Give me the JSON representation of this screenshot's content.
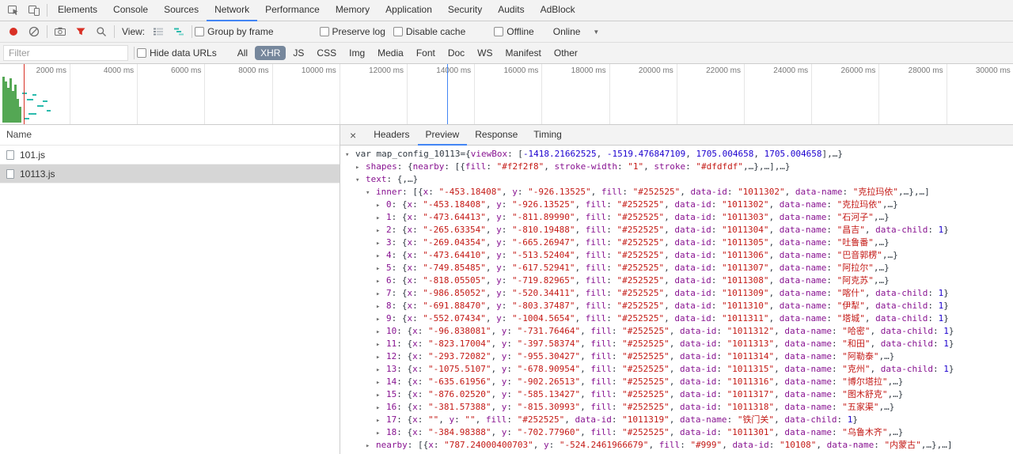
{
  "colors": {
    "accent_blue": "#4285f4",
    "record_red": "#d93025",
    "filter_red": "#d93025",
    "chip_bg": "#76879c",
    "chip_fg": "#ffffff",
    "selection_gray": "#d6d6d6",
    "key": "#881391",
    "string": "#c41a16",
    "number": "#1c00cf",
    "plain": "#303942",
    "bar_green": "#54a754",
    "dash_teal": "#2bbbad",
    "event_blue": "#4285f4",
    "event_red": "#d93025"
  },
  "main_tabs": {
    "items": [
      "Elements",
      "Console",
      "Sources",
      "Network",
      "Performance",
      "Memory",
      "Application",
      "Security",
      "Audits",
      "AdBlock"
    ],
    "active": "Network"
  },
  "net_toolbar": {
    "view_label": "View:",
    "checkboxes": [
      {
        "label": "Group by frame",
        "checked": false
      },
      {
        "label": "Preserve log",
        "checked": false
      },
      {
        "label": "Disable cache",
        "checked": false
      },
      {
        "label": "Offline",
        "checked": false
      }
    ],
    "throttling": {
      "value": "Online"
    }
  },
  "filter_bar": {
    "placeholder": "Filter",
    "hide_data_urls": {
      "label": "Hide data URLs",
      "checked": false
    },
    "types": [
      "All",
      "XHR",
      "JS",
      "CSS",
      "Img",
      "Media",
      "Font",
      "Doc",
      "WS",
      "Manifest",
      "Other"
    ],
    "active_type": "XHR"
  },
  "overview": {
    "tick_labels": [
      "2000 ms",
      "4000 ms",
      "6000 ms",
      "8000 ms",
      "10000 ms",
      "12000 ms",
      "14000 ms",
      "16000 ms",
      "18000 ms",
      "20000 ms",
      "22000 ms",
      "24000 ms",
      "26000 ms",
      "28000 ms",
      "30000 ms"
    ],
    "green_bars": [
      [
        3,
        16,
        58
      ],
      [
        6,
        22,
        52
      ],
      [
        9,
        30,
        44
      ],
      [
        12,
        18,
        56
      ],
      [
        15,
        34,
        40
      ],
      [
        18,
        26,
        48
      ],
      [
        21,
        44,
        30
      ],
      [
        24,
        54,
        20
      ]
    ],
    "teal_dashes": [
      [
        28,
        36,
        6
      ],
      [
        34,
        44,
        8
      ],
      [
        41,
        38,
        5
      ],
      [
        47,
        52,
        8
      ],
      [
        54,
        46,
        6
      ],
      [
        59,
        58,
        5
      ],
      [
        36,
        62,
        10
      ],
      [
        30,
        68,
        7
      ]
    ],
    "event_lines": [
      [
        30,
        "red"
      ],
      [
        565,
        "blue"
      ]
    ]
  },
  "requests": {
    "name_header": "Name",
    "rows": [
      {
        "name": "101.js",
        "selected": false
      },
      {
        "name": "10113.js",
        "selected": true
      }
    ]
  },
  "detail_tabs": {
    "close": "×",
    "items": [
      "Headers",
      "Preview",
      "Response",
      "Timing"
    ],
    "active": "Preview"
  },
  "preview": {
    "header_lines": [
      {
        "ind": 0,
        "ar": "e",
        "tk": [
          [
            "p",
            "var map_config_10113={"
          ],
          [
            "k",
            "viewBox"
          ],
          [
            "p",
            ": ["
          ],
          [
            "n",
            "-1418.21662525"
          ],
          [
            "p",
            ", "
          ],
          [
            "n",
            "-1519.476847109"
          ],
          [
            "p",
            ", "
          ],
          [
            "n",
            "1705.004658"
          ],
          [
            "p",
            ", "
          ],
          [
            "n",
            "1705.004658"
          ],
          [
            "p",
            "],…}"
          ]
        ]
      },
      {
        "ind": 1,
        "ar": "c",
        "tk": [
          [
            "k",
            "shapes"
          ],
          [
            "p",
            ": {"
          ],
          [
            "k",
            "nearby"
          ],
          [
            "p",
            ": [{"
          ],
          [
            "k",
            "fill"
          ],
          [
            "p",
            ": "
          ],
          [
            "s",
            "\"#f2f2f8\""
          ],
          [
            "p",
            ", "
          ],
          [
            "k",
            "stroke-width"
          ],
          [
            "p",
            ": "
          ],
          [
            "s",
            "\"1\""
          ],
          [
            "p",
            ", "
          ],
          [
            "k",
            "stroke"
          ],
          [
            "p",
            ": "
          ],
          [
            "s",
            "\"#dfdfdf\""
          ],
          [
            "p",
            ",…},…],…}"
          ]
        ]
      },
      {
        "ind": 1,
        "ar": "e",
        "tk": [
          [
            "k",
            "text"
          ],
          [
            "p",
            ": {,…}"
          ]
        ]
      },
      {
        "ind": 2,
        "ar": "e",
        "tk": [
          [
            "k",
            "inner"
          ],
          [
            "p",
            ": [{"
          ],
          [
            "k",
            "x"
          ],
          [
            "p",
            ": "
          ],
          [
            "s",
            "\"-453.18408\""
          ],
          [
            "p",
            ", "
          ],
          [
            "k",
            "y"
          ],
          [
            "p",
            ": "
          ],
          [
            "s",
            "\"-926.13525\""
          ],
          [
            "p",
            ", "
          ],
          [
            "k",
            "fill"
          ],
          [
            "p",
            ": "
          ],
          [
            "s",
            "\"#252525\""
          ],
          [
            "p",
            ", "
          ],
          [
            "k",
            "data-id"
          ],
          [
            "p",
            ": "
          ],
          [
            "s",
            "\"1011302\""
          ],
          [
            "p",
            ", "
          ],
          [
            "k",
            "data-name"
          ],
          [
            "p",
            ": "
          ],
          [
            "s",
            "\"克拉玛依\""
          ],
          [
            "p",
            ",…},…]"
          ]
        ]
      }
    ],
    "inner_rows": [
      {
        "i": "0",
        "x": "-453.18408",
        "y": "-926.13525",
        "fill": "#252525",
        "id": "1011302",
        "name": "克拉玛依",
        "child": false
      },
      {
        "i": "1",
        "x": "-473.64413",
        "y": "-811.89990",
        "fill": "#252525",
        "id": "1011303",
        "name": "石河子",
        "child": false
      },
      {
        "i": "2",
        "x": "-265.63354",
        "y": "-810.19488",
        "fill": "#252525",
        "id": "1011304",
        "name": "昌吉",
        "child": true
      },
      {
        "i": "3",
        "x": "-269.04354",
        "y": "-665.26947",
        "fill": "#252525",
        "id": "1011305",
        "name": "吐鲁番",
        "child": false
      },
      {
        "i": "4",
        "x": "-473.64410",
        "y": "-513.52404",
        "fill": "#252525",
        "id": "1011306",
        "name": "巴音郭楞",
        "child": false
      },
      {
        "i": "5",
        "x": "-749.85485",
        "y": "-617.52941",
        "fill": "#252525",
        "id": "1011307",
        "name": "阿拉尔",
        "child": false
      },
      {
        "i": "6",
        "x": "-818.05505",
        "y": "-719.82965",
        "fill": "#252525",
        "id": "1011308",
        "name": "阿克苏",
        "child": false
      },
      {
        "i": "7",
        "x": "-986.85052",
        "y": "-520.34411",
        "fill": "#252525",
        "id": "1011309",
        "name": "喀什",
        "child": true
      },
      {
        "i": "8",
        "x": "-691.88470",
        "y": "-803.37487",
        "fill": "#252525",
        "id": "1011310",
        "name": "伊犁",
        "child": true
      },
      {
        "i": "9",
        "x": "-552.07434",
        "y": "-1004.5654",
        "fill": "#252525",
        "id": "1011311",
        "name": "塔城",
        "child": true
      },
      {
        "i": "10",
        "x": "-96.838081",
        "y": "-731.76464",
        "fill": "#252525",
        "id": "1011312",
        "name": "哈密",
        "child": true
      },
      {
        "i": "11",
        "x": "-823.17004",
        "y": "-397.58374",
        "fill": "#252525",
        "id": "1011313",
        "name": "和田",
        "child": true
      },
      {
        "i": "12",
        "x": "-293.72082",
        "y": "-955.30427",
        "fill": "#252525",
        "id": "1011314",
        "name": "阿勒泰",
        "child": false
      },
      {
        "i": "13",
        "x": "-1075.5107",
        "y": "-678.90954",
        "fill": "#252525",
        "id": "1011315",
        "name": "克州",
        "child": true
      },
      {
        "i": "14",
        "x": "-635.61956",
        "y": "-902.26513",
        "fill": "#252525",
        "id": "1011316",
        "name": "博尔塔拉",
        "child": false
      },
      {
        "i": "15",
        "x": "-876.02520",
        "y": "-585.13427",
        "fill": "#252525",
        "id": "1011317",
        "name": "图木舒克",
        "child": false
      },
      {
        "i": "16",
        "x": "-381.57388",
        "y": "-815.30993",
        "fill": "#252525",
        "id": "1011318",
        "name": "五家渠",
        "child": false
      },
      {
        "i": "17",
        "x": "",
        "y": "",
        "fill": "#252525",
        "id": "1011319",
        "name": "铁门关",
        "child": true
      },
      {
        "i": "18",
        "x": "-384.98388",
        "y": "-702.77960",
        "fill": "#252525",
        "id": "1011301",
        "name": "乌鲁木齐",
        "child": false
      }
    ],
    "footer_lines": [
      {
        "ind": 2,
        "ar": "c",
        "tk": [
          [
            "k",
            "nearby"
          ],
          [
            "p",
            ": [{"
          ],
          [
            "k",
            "x"
          ],
          [
            "p",
            ": "
          ],
          [
            "s",
            "\"787.24000400703\""
          ],
          [
            "p",
            ", "
          ],
          [
            "k",
            "y"
          ],
          [
            "p",
            ": "
          ],
          [
            "s",
            "\"-524.2461966679\""
          ],
          [
            "p",
            ", "
          ],
          [
            "k",
            "fill"
          ],
          [
            "p",
            ": "
          ],
          [
            "s",
            "\"#999\""
          ],
          [
            "p",
            ", "
          ],
          [
            "k",
            "data-id"
          ],
          [
            "p",
            ": "
          ],
          [
            "s",
            "\"10108\""
          ],
          [
            "p",
            ", "
          ],
          [
            "k",
            "data-name"
          ],
          [
            "p",
            ": "
          ],
          [
            "s",
            "\"内蒙古\""
          ],
          [
            "p",
            ",…},…]"
          ]
        ]
      }
    ]
  }
}
